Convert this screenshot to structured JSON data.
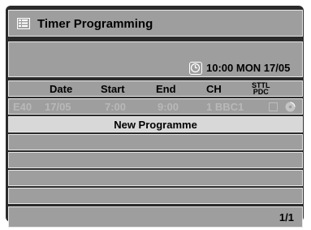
{
  "title": {
    "text": "Timer Programming",
    "icon": "timer-list-icon"
  },
  "clock": {
    "icon": "clock-icon",
    "text": "10:00 MON 17/05"
  },
  "columns": {
    "date": "Date",
    "start": "Start",
    "end": "End",
    "ch": "CH",
    "sttl": "STTL",
    "pdc": "PDC"
  },
  "programmes": [
    {
      "id": "E40",
      "date": "17/05",
      "start": "7:00",
      "end": "9:00",
      "ch": "1 BBC1",
      "sttl_pdc_checked": false,
      "media_icon": "disc-icon"
    }
  ],
  "new_programme_label": "New Programme",
  "page_indicator": "1/1",
  "colors": {
    "frame": "#2b2b2b",
    "panel": "#9e9e9e",
    "panel_border": "#e6e6e6",
    "highlight_row": "#d8d8d8",
    "dim_text": "#b8b8b8"
  }
}
